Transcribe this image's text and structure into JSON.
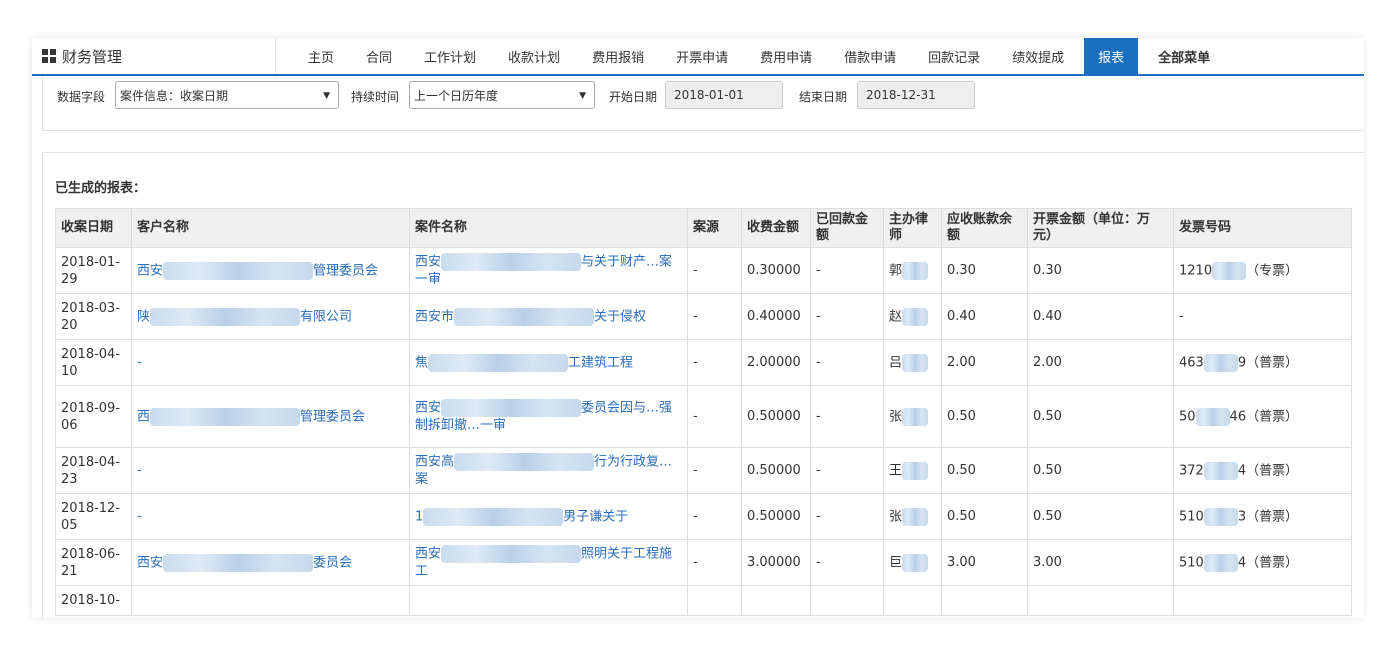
{
  "app": {
    "title": "财务管理"
  },
  "nav": {
    "items": [
      "主页",
      "合同",
      "工作计划",
      "收款计划",
      "费用报销",
      "开票申请",
      "费用申请",
      "借款申请",
      "回款记录",
      "绩效提成"
    ],
    "active": "报表",
    "all_menu": "全部菜单"
  },
  "filters": {
    "field_label": "数据字段",
    "field_value": "案件信息：收案日期",
    "duration_label": "持续时间",
    "duration_value": "上一个日历年度",
    "start_label": "开始日期",
    "start_value": "2018-01-01",
    "end_label": "结束日期",
    "end_value": "2018-12-31"
  },
  "report": {
    "title": "已生成的报表：",
    "headers": [
      "收案日期",
      "客户名称",
      "案件名称",
      "案源",
      "收费金额",
      "已回款金额",
      "主办律师",
      "应收账款余额",
      "开票金额（单位：万元）",
      "发票号码"
    ],
    "rows": [
      {
        "date": "2018-01-29",
        "client_pre": "西安",
        "client_post": "管理委员会",
        "case_pre": "西安",
        "case_post": "与关于财产…案一审",
        "source": "-",
        "fee": "0.30000",
        "received": "-",
        "lawyer": "郭",
        "balance": "0.30",
        "invoice_amt": "0.30",
        "invoice_pre": "1210",
        "invoice_post": "（专票）"
      },
      {
        "date": "2018-03-20",
        "client_pre": "陕",
        "client_post": "有限公司",
        "case_pre": "西安市",
        "case_post": "关于侵权",
        "source": "-",
        "fee": "0.40000",
        "received": "-",
        "lawyer": "赵",
        "balance": "0.40",
        "invoice_amt": "0.40",
        "invoice_pre": "-",
        "invoice_post": ""
      },
      {
        "date": "2018-04-10",
        "client_pre": "-",
        "client_post": "",
        "case_pre": "焦",
        "case_post": "工建筑工程",
        "source": "-",
        "fee": "2.00000",
        "received": "-",
        "lawyer": "吕",
        "balance": "2.00",
        "invoice_amt": "2.00",
        "invoice_pre": "463",
        "invoice_post": "9（普票）"
      },
      {
        "date": "2018-09-06",
        "client_pre": "西",
        "client_post": "管理委员会",
        "case_pre": "西安",
        "case_post": "委员会因与…强制拆卸撤…一审",
        "source": "-",
        "fee": "0.50000",
        "received": "-",
        "lawyer": "张",
        "balance": "0.50",
        "invoice_amt": "0.50",
        "invoice_pre": "50",
        "invoice_post": "46（普票）"
      },
      {
        "date": "2018-04-23",
        "client_pre": "-",
        "client_post": "",
        "case_pre": "西安高",
        "case_post": "行为行政复…案",
        "source": "-",
        "fee": "0.50000",
        "received": "-",
        "lawyer": "王",
        "balance": "0.50",
        "invoice_amt": "0.50",
        "invoice_pre": "372",
        "invoice_post": "4（普票）"
      },
      {
        "date": "2018-12-05",
        "client_pre": "-",
        "client_post": "",
        "case_pre": "1",
        "case_post": "男子谦关于",
        "source": "-",
        "fee": "0.50000",
        "received": "-",
        "lawyer": "张",
        "balance": "0.50",
        "invoice_amt": "0.50",
        "invoice_pre": "510",
        "invoice_post": "3（普票）"
      },
      {
        "date": "2018-06-21",
        "client_pre": "西安",
        "client_post": "委员会",
        "case_pre": "西安",
        "case_post": "照明关于工程施工",
        "source": "-",
        "fee": "3.00000",
        "received": "-",
        "lawyer": "巨",
        "balance": "3.00",
        "invoice_amt": "3.00",
        "invoice_pre": "510",
        "invoice_post": "4（普票）"
      },
      {
        "date": "2018-10-",
        "client_pre": "",
        "client_post": "",
        "case_pre": "",
        "case_post": "",
        "source": "",
        "fee": "",
        "received": "",
        "lawyer": "",
        "balance": "",
        "invoice_amt": "",
        "invoice_pre": "",
        "invoice_post": ""
      }
    ]
  }
}
